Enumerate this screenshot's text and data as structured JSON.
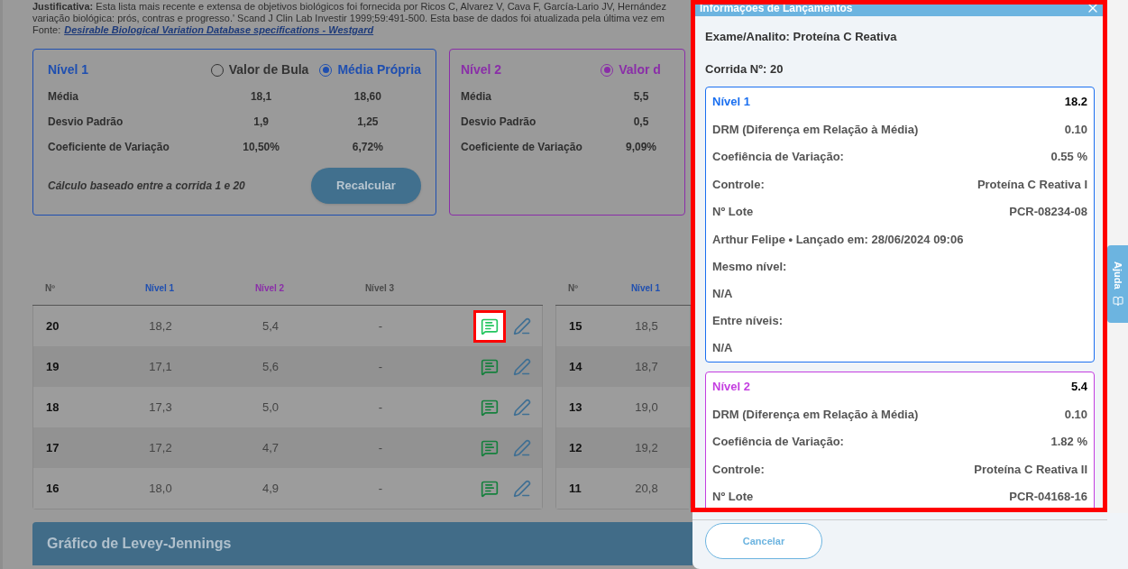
{
  "justification": {
    "text": "**Justificativa:** Esta lista mais recente e extensa de objetivos biológicos foi fornecida por Ricos C, Alvarez V, Cava F, García-Lario JV, Hernández",
    "text_2": "variação biológica: prós, contras e progresso.' Scand J Clin Lab Investir 1999;59:491-500. Esta base de dados foi atualizada pela última vez em",
    "source_label": "Fonte:",
    "source_link": "Desirable Biological Variation Database specifications - Westgard"
  },
  "level_cards": [
    {
      "title": "Nível 1",
      "color": "#1f4fb0",
      "options": [
        {
          "label": "Valor de Bula",
          "selected": false
        },
        {
          "label": "Média Própria",
          "selected": true
        }
      ],
      "rows": [
        {
          "label": "Média",
          "values": [
            "18,1",
            "18,60"
          ]
        },
        {
          "label": "Desvio Padrão",
          "values": [
            "1,9",
            "1,25"
          ]
        },
        {
          "label": "Coeficiente de Variação",
          "values": [
            "10,50%",
            "6,72%"
          ]
        }
      ],
      "footnote": "Cálculo baseado entre a corrida 1 e 20",
      "button": "Recalcular"
    },
    {
      "title": "Nível 2",
      "color": "#8a2ea8",
      "options": [
        {
          "label": "Valor d",
          "selected": true
        }
      ],
      "rows": [
        {
          "label": "Média",
          "values": [
            "5,5"
          ]
        },
        {
          "label": "Desvio Padrão",
          "values": [
            "0,5"
          ]
        },
        {
          "label": "Coeficiente de Variação",
          "values": [
            "9,09%"
          ]
        }
      ]
    }
  ],
  "tables": [
    {
      "columns": [
        {
          "label": "Nº",
          "color": "#4a4a4a"
        },
        {
          "label": "Nível 1",
          "color": "#1f4fb0"
        },
        {
          "label": "Nível 2",
          "color": "#8a2ea8"
        },
        {
          "label": "Nível 3",
          "color": "#4a4a4a"
        }
      ],
      "rows": [
        {
          "cells": [
            "20",
            "18,2",
            "5,4",
            "-"
          ],
          "highlighted": true
        },
        {
          "cells": [
            "19",
            "17,1",
            "5,6",
            "-"
          ],
          "highlighted": false
        },
        {
          "cells": [
            "18",
            "17,3",
            "5,0",
            "-"
          ],
          "highlighted": false
        },
        {
          "cells": [
            "17",
            "17,2",
            "4,7",
            "-"
          ],
          "highlighted": false
        },
        {
          "cells": [
            "16",
            "18,0",
            "4,9",
            "-"
          ],
          "highlighted": false
        }
      ]
    },
    {
      "columns": [
        {
          "label": "Nº",
          "color": "#4a4a4a"
        },
        {
          "label": "Nível 1",
          "color": "#1f4fb0"
        }
      ],
      "rows": [
        {
          "cells": [
            "15",
            "18,5"
          ]
        },
        {
          "cells": [
            "14",
            "18,7"
          ]
        },
        {
          "cells": [
            "13",
            "19,0"
          ]
        },
        {
          "cells": [
            "12",
            "19,2"
          ]
        },
        {
          "cells": [
            "11",
            "20,8"
          ]
        }
      ]
    }
  ],
  "chart_section": {
    "title": "Gráfico de Levey-Jennings"
  },
  "panel": {
    "title": "Informações de Lançamentos",
    "highlighted": true,
    "exam": "Exame/Analito: Proteína C Reativa",
    "run": "Corrida Nº: 20",
    "levels": [
      {
        "title": "Nível 1",
        "color": "#1a6ff0",
        "value": "18.2",
        "fields": [
          {
            "label": "DRM (Diferença em Relação à Média)",
            "value": "0.10"
          },
          {
            "label": "Coefiência de Variação:",
            "value": "0.55 %"
          },
          {
            "label": "Controle:",
            "value": "Proteína C Reativa I"
          },
          {
            "label": "Nº Lote",
            "value": "PCR-08234-08"
          }
        ],
        "note": "Arthur Felipe • Lançado em: 28/06/2024 09:06",
        "groups": [
          {
            "label": "Mesmo nível:",
            "value": "N/A"
          },
          {
            "label": "Entre níveis:",
            "value": "N/A"
          }
        ]
      },
      {
        "title": "Nível 2",
        "color": "#c43ee0",
        "value": "5.4",
        "fields": [
          {
            "label": "DRM (Diferença em Relação à Média)",
            "value": "0.10"
          },
          {
            "label": "Coefiência de Variação:",
            "value": "1.82 %"
          },
          {
            "label": "Controle:",
            "value": "Proteína C Reativa II"
          },
          {
            "label": "Nº Lote",
            "value": "PCR-04168-16"
          }
        ]
      }
    ],
    "cancel": "Cancelar"
  },
  "help_tab": {
    "label": "Ajuda"
  }
}
